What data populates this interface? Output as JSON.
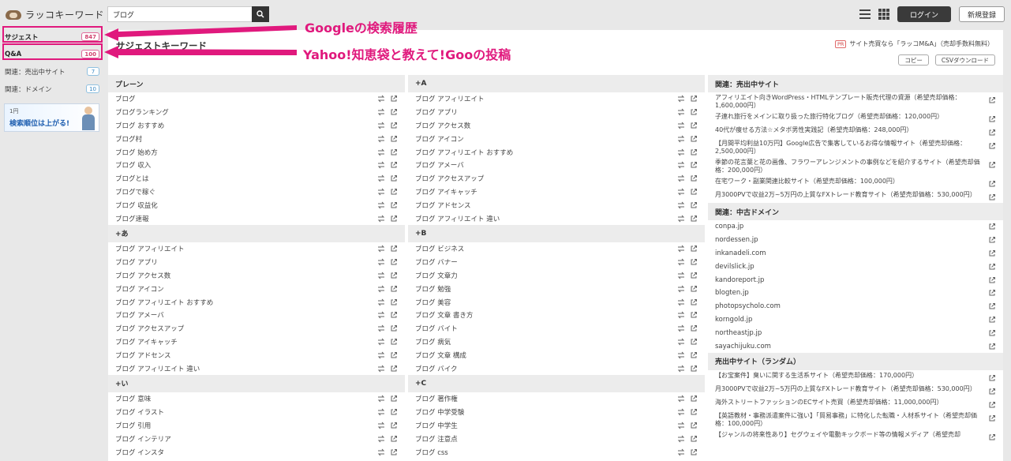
{
  "app": {
    "name": "ラッコキーワード"
  },
  "search": {
    "value": "ブログ",
    "placeholder": ""
  },
  "header": {
    "login": "ログイン",
    "signup": "新規登録"
  },
  "sidebar": {
    "items": [
      {
        "label": "サジェスト",
        "count": "847"
      },
      {
        "label": "Q&A",
        "count": "100"
      },
      {
        "label": "関連：売出中サイト",
        "count": "7"
      },
      {
        "label": "関連：ドメイン",
        "count": "10"
      }
    ],
    "banner": {
      "line1": "1円",
      "line2": "検索順位は上がる!"
    }
  },
  "main": {
    "title": "サジェストキーワード",
    "ad": {
      "badge": "PR",
      "text": "サイト売買なら「ラッコM&A」（売却手数料無料）"
    },
    "copy_button": "コピー",
    "csv_button": "CSVダウンロード"
  },
  "columns": {
    "plain": {
      "header": "プレーン",
      "items": [
        "ブログ",
        "ブログランキング",
        "ブログ おすすめ",
        "ブログ村",
        "ブログ 始め方",
        "ブログ 収入",
        "ブログとは",
        "ブログで稼ぐ",
        "ブログ 収益化",
        "ブログ速報"
      ]
    },
    "plus_a_upper": {
      "header": "+A",
      "items": [
        "ブログ アフィリエイト",
        "ブログ アプリ",
        "ブログ アクセス数",
        "ブログ アイコン",
        "ブログ アフィリエイト おすすめ",
        "ブログ アメーバ",
        "ブログ アクセスアップ",
        "ブログ アイキャッチ",
        "ブログ アドセンス",
        "ブログ アフィリエイト 違い"
      ]
    },
    "plus_a": {
      "header": "+あ",
      "items": [
        "ブログ アフィリエイト",
        "ブログ アプリ",
        "ブログ アクセス数",
        "ブログ アイコン",
        "ブログ アフィリエイト おすすめ",
        "ブログ アメーバ",
        "ブログ アクセスアップ",
        "ブログ アイキャッチ",
        "ブログ アドセンス",
        "ブログ アフィリエイト 違い"
      ]
    },
    "plus_b": {
      "header": "+B",
      "items": [
        "ブログ ビジネス",
        "ブログ バナー",
        "ブログ 文章力",
        "ブログ 勉強",
        "ブログ 美容",
        "ブログ 文章 書き方",
        "ブログ バイト",
        "ブログ 病気",
        "ブログ 文章 構成",
        "ブログ バイク"
      ]
    },
    "plus_i": {
      "header": "+い",
      "items": [
        "ブログ 意味",
        "ブログ イラスト",
        "ブログ 引用",
        "ブログ インテリア",
        "ブログ インスタ"
      ]
    },
    "plus_c": {
      "header": "+C",
      "items": [
        "ブログ 著作権",
        "ブログ 中学受験",
        "ブログ 中学生",
        "ブログ 注意点",
        "ブログ css"
      ]
    }
  },
  "related_sites": {
    "header": "関連：売出中サイト",
    "items": [
      "アフィリエイト向きWordPress・HTMLテンプレート販売代理の資源（希望売却価格：1,600,000円）",
      "子連れ旅行をメインに取り扱った旅行特化ブログ（希望売却価格：120,000円）",
      "40代が痩せる方法☆メタボ男性実践記（希望売却価格：248,000円）",
      "【月間平均利益10万円】Google広告で集客しているお得な情報サイト（希望売却価格：2,500,000円）",
      "季節の花言葉と花の画像、フラワーアレンジメントの事例などを紹介するサイト（希望売却価格：200,000円）",
      "在宅ワーク・副業関連比較サイト（希望売却価格：100,000円）",
      "月3000PVで収益2万~5万円の上質なFXトレード教育サイト（希望売却価格：530,000円）"
    ]
  },
  "related_domains": {
    "header": "関連：中古ドメイン",
    "items": [
      "conpa.jp",
      "nordessen.jp",
      "inkanadeli.com",
      "devilslick.jp",
      "kandoreport.jp",
      "blogten.jp",
      "photopsycholo.com",
      "korngold.jp",
      "northeastjp.jp",
      "sayachijuku.com"
    ]
  },
  "random_sites": {
    "header": "売出中サイト（ランダム）",
    "items": [
      "【お宝案件】臭いに関する生活系サイト（希望売却価格：170,000円）",
      "月3000PVで収益2万~5万円の上質なFXトレード教育サイト（希望売却価格：530,000円）",
      "海外ストリートファッションのECサイト売買（希望売却価格：11,000,000円）",
      "【英語教材・事務派遣案件に強い】「貿易事務」に特化した転職・人材系サイト（希望売却価格：100,000円）",
      "【ジャンルの将来性あり】セグウェイや電動キックボード等の情報メディア（希望売却"
    ]
  },
  "annotations": {
    "google": "Googleの検索履歴",
    "yahoo": "Yahoo!知恵袋と教えて!Gooの投稿"
  },
  "colors": {
    "highlight": "#e0197d",
    "login_bg": "#3a3a3a"
  }
}
